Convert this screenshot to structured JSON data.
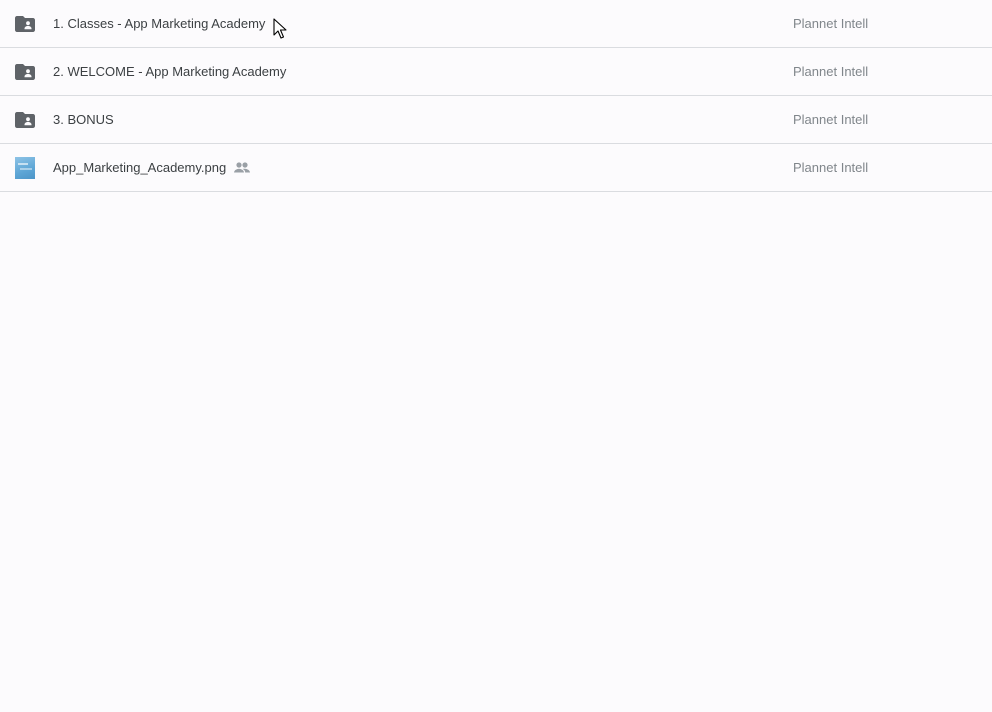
{
  "files": [
    {
      "name": "1. Classes - App Marketing Academy",
      "owner": "Plannet Intell",
      "type": "shared-folder",
      "icon": "shared-folder-icon",
      "shared": false
    },
    {
      "name": "2. WELCOME - App Marketing Academy",
      "owner": "Plannet Intell",
      "type": "shared-folder",
      "icon": "shared-folder-icon",
      "shared": false
    },
    {
      "name": "3. BONUS",
      "owner": "Plannet Intell",
      "type": "shared-folder",
      "icon": "shared-folder-icon",
      "shared": false
    },
    {
      "name": "App_Marketing_Academy.png",
      "owner": "Plannet Intell",
      "type": "image",
      "icon": "image-thumbnail",
      "shared": true,
      "shared_icon": "people-icon"
    }
  ],
  "colors": {
    "background": "#fcfbfd",
    "divider": "#dadce0",
    "name_text": "#3c4043",
    "owner_text": "#80868b",
    "folder_icon": "#5f6368"
  }
}
